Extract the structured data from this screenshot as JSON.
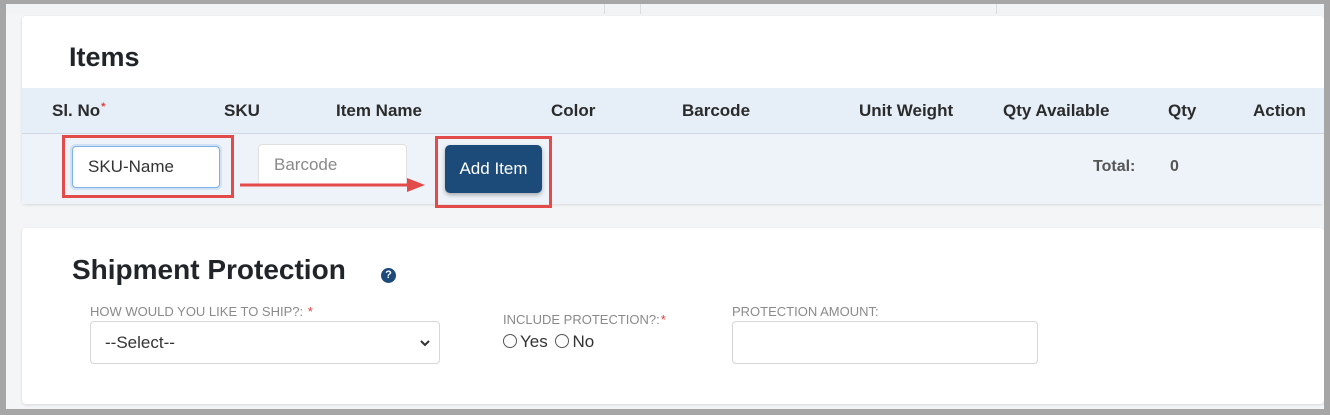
{
  "items_section": {
    "title": "Items",
    "columns": [
      "Sl. No",
      "SKU",
      "Item Name",
      "Color",
      "Barcode",
      "Unit Weight",
      "Qty Available",
      "Qty",
      "Action"
    ],
    "required_marker": "*",
    "row": {
      "sku_input_value": "SKU-Name",
      "barcode_placeholder": "Barcode",
      "add_item_label": "Add Item",
      "total_label": "Total:",
      "total_value": "0"
    }
  },
  "shipment_section": {
    "title": "Shipment Protection",
    "help_icon": "question-circle-icon",
    "ship_method_label": "HOW WOULD YOU LIKE TO SHIP?:",
    "ship_method_selected": "--Select--",
    "include_protection_label": "INCLUDE PROTECTION?:",
    "options": [
      "Yes",
      "No"
    ],
    "protection_amount_label": "PROTECTION AMOUNT:",
    "protection_amount_value": ""
  },
  "colors": {
    "primary_button": "#1c4a79",
    "table_header_bg": "#e6eef8",
    "highlight": "#e34a4a",
    "required": "#e03b3b"
  }
}
